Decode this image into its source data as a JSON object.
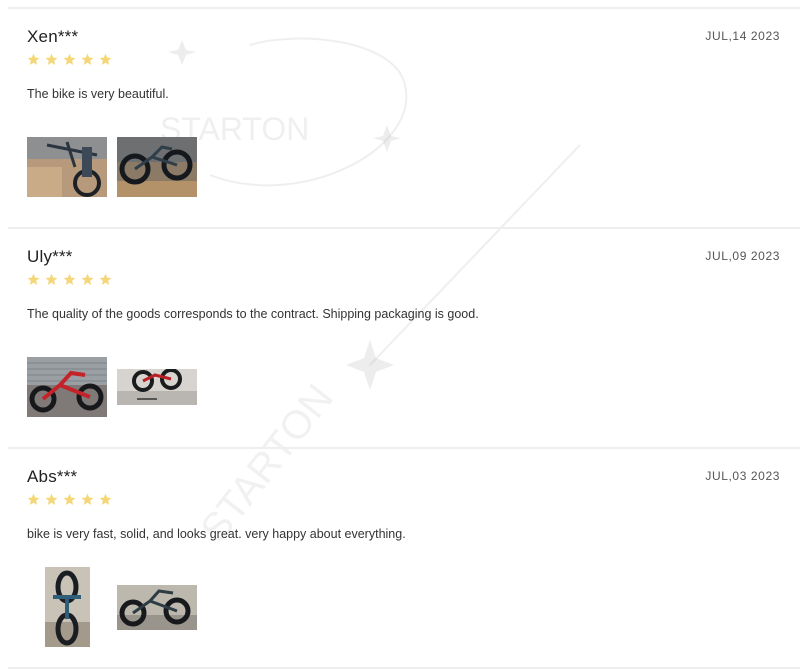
{
  "reviews": [
    {
      "author": "Xen***",
      "date": "JUL,14 2023",
      "rating": 5,
      "text": "The bike is very beautiful.",
      "photos": [
        "review-photo",
        "review-photo"
      ]
    },
    {
      "author": "Uly***",
      "date": "JUL,09 2023",
      "rating": 5,
      "text": "The quality of the goods corresponds to the contract. Shipping packaging is good.",
      "photos": [
        "review-photo",
        "review-photo"
      ]
    },
    {
      "author": "Abs***",
      "date": "JUL,03 2023",
      "rating": 5,
      "text": "bike is very fast, solid, and looks great. very happy about everything.",
      "photos": [
        "review-photo",
        "review-photo"
      ]
    }
  ],
  "watermark": {
    "text": "STARTON"
  },
  "colors": {
    "star": "#f3d77a",
    "divider": "#eeeeee",
    "author": "#222222",
    "date": "#555555"
  }
}
